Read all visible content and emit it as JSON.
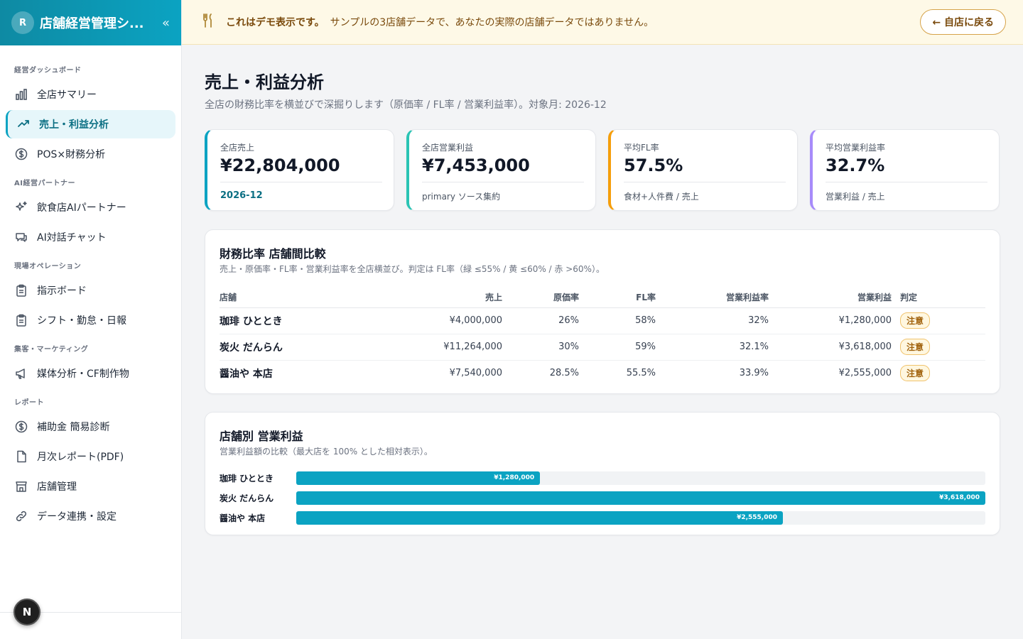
{
  "sidebar": {
    "avatar": "R",
    "title": "店舗経営管理シ...",
    "collapse": "«",
    "sections": [
      {
        "label": "経営ダッシュボード",
        "items": [
          {
            "label": "全店サマリー",
            "icon": "bar-chart-icon"
          },
          {
            "label": "売上・利益分析",
            "icon": "trending-up-icon",
            "active": true
          },
          {
            "label": "POS×財務分析",
            "icon": "dollar-circle-icon"
          }
        ]
      },
      {
        "label": "AI経営パートナー",
        "items": [
          {
            "label": "飲食店AIパートナー",
            "icon": "sparkles-icon"
          },
          {
            "label": "AI対話チャット",
            "icon": "chat-icon"
          }
        ]
      },
      {
        "label": "現場オペレーション",
        "items": [
          {
            "label": "指示ボード",
            "icon": "clipboard-icon"
          },
          {
            "label": "シフト・勤怠・日報",
            "icon": "clipboard-icon"
          }
        ]
      },
      {
        "label": "集客・マーケティング",
        "items": [
          {
            "label": "媒体分析・CF制作物",
            "icon": "megaphone-icon"
          }
        ]
      },
      {
        "label": "レポート",
        "items": [
          {
            "label": "補助金 簡易診断",
            "icon": "dollar-circle-icon"
          },
          {
            "label": "月次レポート(PDF)",
            "icon": "file-icon"
          },
          {
            "label": "店舗管理",
            "icon": "store-icon"
          },
          {
            "label": "データ連携・設定",
            "icon": "link-icon"
          }
        ]
      }
    ],
    "badge": "N"
  },
  "banner": {
    "strong": "これはデモ表示です。",
    "text": "サンプルの3店舗データで、あなたの実際の店舗データではありません。",
    "back_label": "← 自店に戻る"
  },
  "page": {
    "title": "売上・利益分析",
    "subtitle": "全店の財務比率を横並びで深掘りします（原価率 / FL率 / 営業利益率）。対象月: 2026-12"
  },
  "kpis": [
    {
      "label": "全店売上",
      "value": "¥22,804,000",
      "foot": "2026-12",
      "color": "#0ba3c2",
      "accent": true
    },
    {
      "label": "全店営業利益",
      "value": "¥7,453,000",
      "foot": "primary ソース集約",
      "color": "#2bc4b4"
    },
    {
      "label": "平均FL率",
      "value": "57.5%",
      "foot": "食材+人件費 / 売上",
      "color": "#f59e0b"
    },
    {
      "label": "平均営業利益率",
      "value": "32.7%",
      "foot": "営業利益 / 売上",
      "color": "#a78bfa"
    }
  ],
  "ratio_table": {
    "title": "財務比率 店舗間比較",
    "subtitle": "売上・原価率・FL率・営業利益率を全店横並び。判定は FL率（緑 ≤55% / 黄 ≤60% / 赤 >60%）。",
    "headers": [
      "店舗",
      "売上",
      "原価率",
      "FL率",
      "営業利益率",
      "営業利益",
      "判定"
    ],
    "rows": [
      [
        "珈琲 ひととき",
        "¥4,000,000",
        "26%",
        "58%",
        "32%",
        "¥1,280,000",
        "注意"
      ],
      [
        "炭火 だんらん",
        "¥11,264,000",
        "30%",
        "59%",
        "32.1%",
        "¥3,618,000",
        "注意"
      ],
      [
        "醤油や 本店",
        "¥7,540,000",
        "28.5%",
        "55.5%",
        "33.9%",
        "¥2,555,000",
        "注意"
      ]
    ]
  },
  "profit_chart": {
    "title": "店舗別 営業利益",
    "subtitle": "営業利益額の比較（最大店を 100% とした相対表示）。"
  },
  "chart_data": {
    "type": "bar",
    "orientation": "horizontal",
    "categories": [
      "珈琲 ひととき",
      "炭火 だんらん",
      "醤油や 本店"
    ],
    "values": [
      1280000,
      3618000,
      2555000
    ],
    "labels": [
      "¥1,280,000",
      "¥3,618,000",
      "¥2,555,000"
    ],
    "xlim": [
      0,
      3618000
    ]
  }
}
